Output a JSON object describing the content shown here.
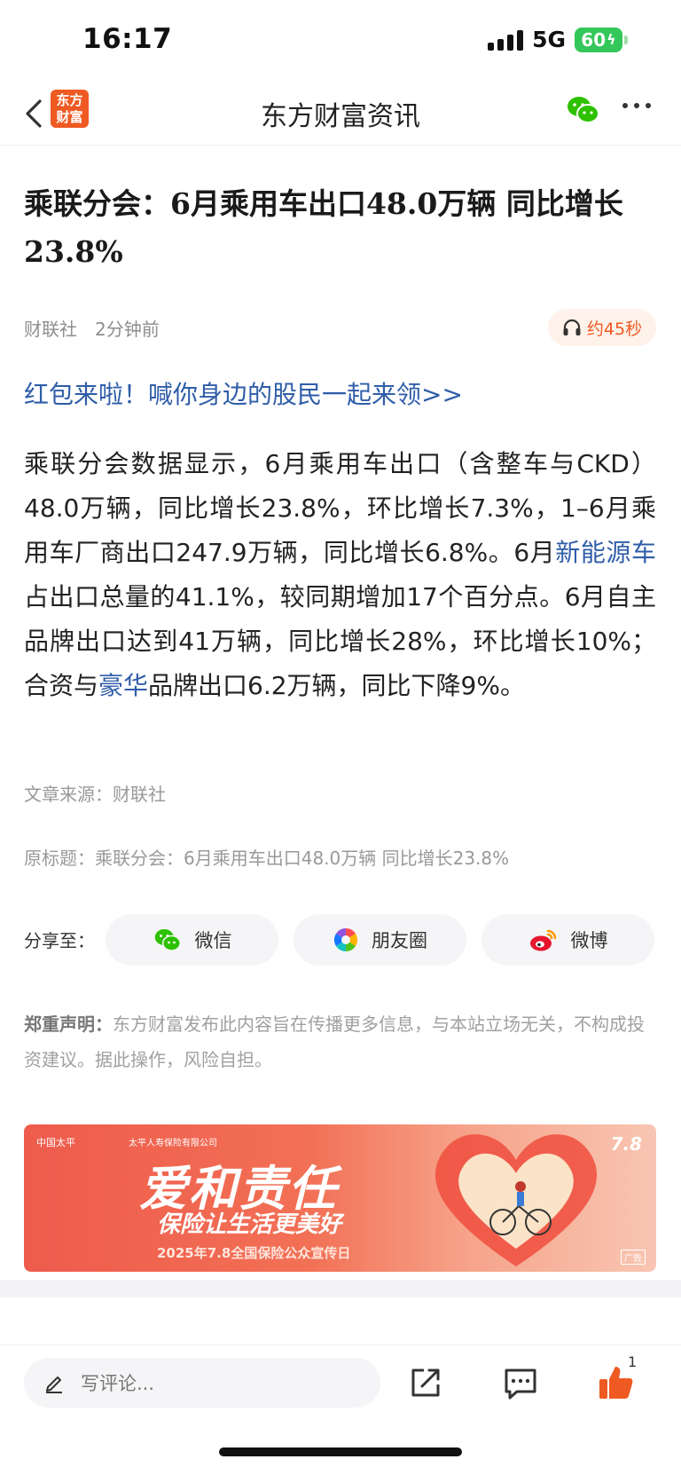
{
  "status_bar": {
    "time": "16:17",
    "network": "5G",
    "battery": "60"
  },
  "nav": {
    "logo_line1": "东方",
    "logo_line2": "财富",
    "title": "东方财富资讯"
  },
  "article": {
    "headline": "乘联分会：6月乘用车出口48.0万辆 同比增长23.8%",
    "source_name": "财联社",
    "time_ago": "2分钟前",
    "audio_label": "约45秒",
    "promo_link": "红包来啦！喊你身边的股民一起来领>>",
    "body": {
      "p1": "乘联分会数据显示，6月乘用车出口（含整车与CKD）48.0万辆，同比增长23.8%，环比增长7.3%，1–6月乘用车厂商出口247.9万辆，同比增长6.8%。6月",
      "kw1": "新能源车",
      "p2": "占出口总量的41.1%，较同期增加17个百分点。6月自主品牌出口达到41万辆，同比增长28%，环比增长10%；合资与",
      "kw2": "豪华",
      "p3": "品牌出口6.2万辆，同比下降9%。"
    },
    "article_source": "文章来源：财联社",
    "original_title": "原标题：乘联分会：6月乘用车出口48.0万辆 同比增长23.8%"
  },
  "share": {
    "label": "分享至：",
    "wechat": "微信",
    "moments": "朋友圈",
    "weibo": "微博"
  },
  "disclaimer": {
    "title": "郑重声明：",
    "text": "东方财富发布此内容旨在传播更多信息，与本站立场无关，不构成投资建议。据此操作，风险自担。"
  },
  "banner": {
    "brand": "中国太平",
    "brand2": "太平人寿保险有限公司",
    "main": "爱和责任",
    "sub": "保险让生活更美好",
    "date": "2025年7.8全国保险公众宣传日",
    "ad": "广告",
    "logo78": "7.8"
  },
  "bottom_bar": {
    "comment_placeholder": "写评论...",
    "like_count": "1"
  },
  "colors": {
    "accent": "#ef5a22",
    "link": "#2f5da8",
    "wechat_green": "#2dc100"
  }
}
